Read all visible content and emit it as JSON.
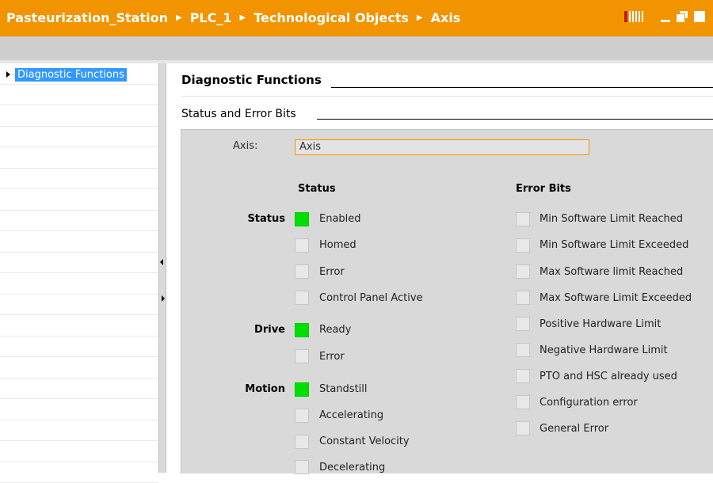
{
  "header": {
    "breadcrumbs": [
      "Pasteurization_Station",
      "PLC_1",
      "Technological Objects",
      "Axis"
    ],
    "accent_color": "#f29400"
  },
  "sidebar": {
    "items": [
      {
        "label": "Diagnostic Functions",
        "selected": true
      }
    ]
  },
  "main": {
    "title": "Diagnostic Functions",
    "section_title": "Status and Error Bits",
    "axis_label": "Axis:",
    "axis_value": "Axis",
    "status_heading": "Status",
    "error_heading": "Error Bits",
    "status_groups": [
      {
        "name": "Status",
        "items": [
          {
            "label": "Enabled",
            "on": true
          },
          {
            "label": "Homed",
            "on": false
          },
          {
            "label": "Error",
            "on": false
          },
          {
            "label": "Control Panel Active",
            "on": false
          }
        ]
      },
      {
        "name": "Drive",
        "items": [
          {
            "label": "Ready",
            "on": true
          },
          {
            "label": "Error",
            "on": false
          }
        ]
      },
      {
        "name": "Motion",
        "items": [
          {
            "label": "Standstill",
            "on": true
          },
          {
            "label": "Accelerating",
            "on": false
          },
          {
            "label": "Constant Velocity",
            "on": false
          },
          {
            "label": "Decelerating",
            "on": false
          }
        ]
      }
    ],
    "error_bits": [
      {
        "label": "Min Software Limit Reached",
        "on": false
      },
      {
        "label": "Min Software Limit Exceeded",
        "on": false
      },
      {
        "label": "Max Software limit Reached",
        "on": false
      },
      {
        "label": "Max Software Limit Exceeded",
        "on": false
      },
      {
        "label": "Positive Hardware Limit",
        "on": false
      },
      {
        "label": "Negative Hardware Limit",
        "on": false
      },
      {
        "label": "PTO and HSC already used",
        "on": false
      },
      {
        "label": "Configuration error",
        "on": false
      },
      {
        "label": "General Error",
        "on": false
      }
    ],
    "active_color": "#00e000"
  }
}
